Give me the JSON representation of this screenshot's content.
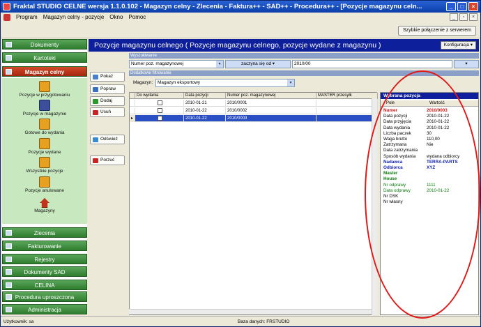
{
  "window": {
    "title": "Fraktal STUDIO CELNE  wersja 1.1.0.102 - Magazyn celny - Zlecenia - Faktura++ - SAD++ - Procedura++ - [Pozycje magazynu celn..."
  },
  "menu": [
    "Program",
    "Magazyn celny - pozycje",
    "Okno",
    "Pomoc"
  ],
  "toolbar": {
    "quick_connect": "Szybkie połączenie z serwerem"
  },
  "sidebar": {
    "top_buttons": [
      "Dokumenty",
      "Kartoteki"
    ],
    "active_section": "Magazyn celny",
    "items": [
      "Pozycje w przygotowaniu",
      "Pozycje w magazynie",
      "Gotowe do wydania",
      "Pozycje wydane",
      "Wszystkie pozycje",
      "Pozycje anulowane",
      "Magazyny"
    ],
    "bottom_buttons": [
      "Zlecenia",
      "Fakturowanie",
      "Rejestry",
      "Dokumenty SAD",
      "CELINA",
      "Procedura uproszczona",
      "Administracja"
    ]
  },
  "main": {
    "header": "Pozycje magazynu celnego ( Pozycje magazynu celnego, pozycje wydane z magazynu )",
    "config_button": "Konfiguracja",
    "search": {
      "section_label": "Wyszukiwanie",
      "field": "Numer poz. magazynowej",
      "mode": "zaczyna się od",
      "value": "2010/00"
    },
    "filter": {
      "section_label": "Dodatkowe filtrowanie",
      "label": "Magazyn:",
      "value": "Magazyn eksportowy"
    },
    "actions": [
      "Pokaż",
      "Popraw",
      "Dodaj",
      "Usuń",
      "Odśwież",
      "Porzuć"
    ],
    "grid": {
      "columns": [
        "Do wydania",
        "Data pozycji",
        "Numer poz. magazynowej",
        "MASTER przesyłk"
      ],
      "rows": [
        {
          "date": "2010-01-21",
          "number": "2010/0001"
        },
        {
          "date": "2010-01-22",
          "number": "2010/0002"
        },
        {
          "date": "2010-01-22",
          "number": "2010/0003"
        }
      ]
    }
  },
  "detail": {
    "title": "Wybrana pozycja",
    "col_label": "Pole",
    "col_value": "Wartość",
    "rows": [
      {
        "label": "Numer",
        "value": "2010/0003",
        "color": "#d01010",
        "bold": true
      },
      {
        "label": "Data pozycji",
        "value": "2010-01-22",
        "color": "#000000",
        "bold": false
      },
      {
        "label": "Data przyjęcia",
        "value": "2010-01-22",
        "color": "#000000",
        "bold": false
      },
      {
        "label": "Data wydania",
        "value": "2010-01-22",
        "color": "#000000",
        "bold": false
      },
      {
        "label": "Liczba paczek",
        "value": "30",
        "color": "#000000",
        "bold": false
      },
      {
        "label": "Waga brutto",
        "value": "110,00",
        "color": "#000000",
        "bold": false
      },
      {
        "label": "Zatrzymana",
        "value": "Nie",
        "color": "#000000",
        "bold": false
      },
      {
        "label": "Data zatrzymania",
        "value": "",
        "color": "#000000",
        "bold": false
      },
      {
        "label": "Sposób wydania",
        "value": "wydana odbiorcy",
        "color": "#000000",
        "bold": false
      },
      {
        "label": "Nadawca",
        "value": "TERRA-PARTS",
        "color": "#1022b0",
        "bold": true
      },
      {
        "label": "Odbiorca",
        "value": "XYZ",
        "color": "#1022b0",
        "bold": true
      },
      {
        "label": "Master",
        "value": "",
        "color": "#0a7a0a",
        "bold": true
      },
      {
        "label": "House",
        "value": "",
        "color": "#0a7a0a",
        "bold": true
      },
      {
        "label": "Nr odprawy",
        "value": "1111",
        "color": "#0a7a0a",
        "bold": false
      },
      {
        "label": "Data odprawy",
        "value": "2010-01-22",
        "color": "#0a7a0a",
        "bold": false
      },
      {
        "label": "Nr DSK",
        "value": "",
        "color": "#000000",
        "bold": false
      },
      {
        "label": "Nr własny",
        "value": "",
        "color": "#000000",
        "bold": false
      }
    ]
  },
  "status": {
    "user": "Użytkownik: sa",
    "db": "Baza danych: FRSTUDIO"
  }
}
